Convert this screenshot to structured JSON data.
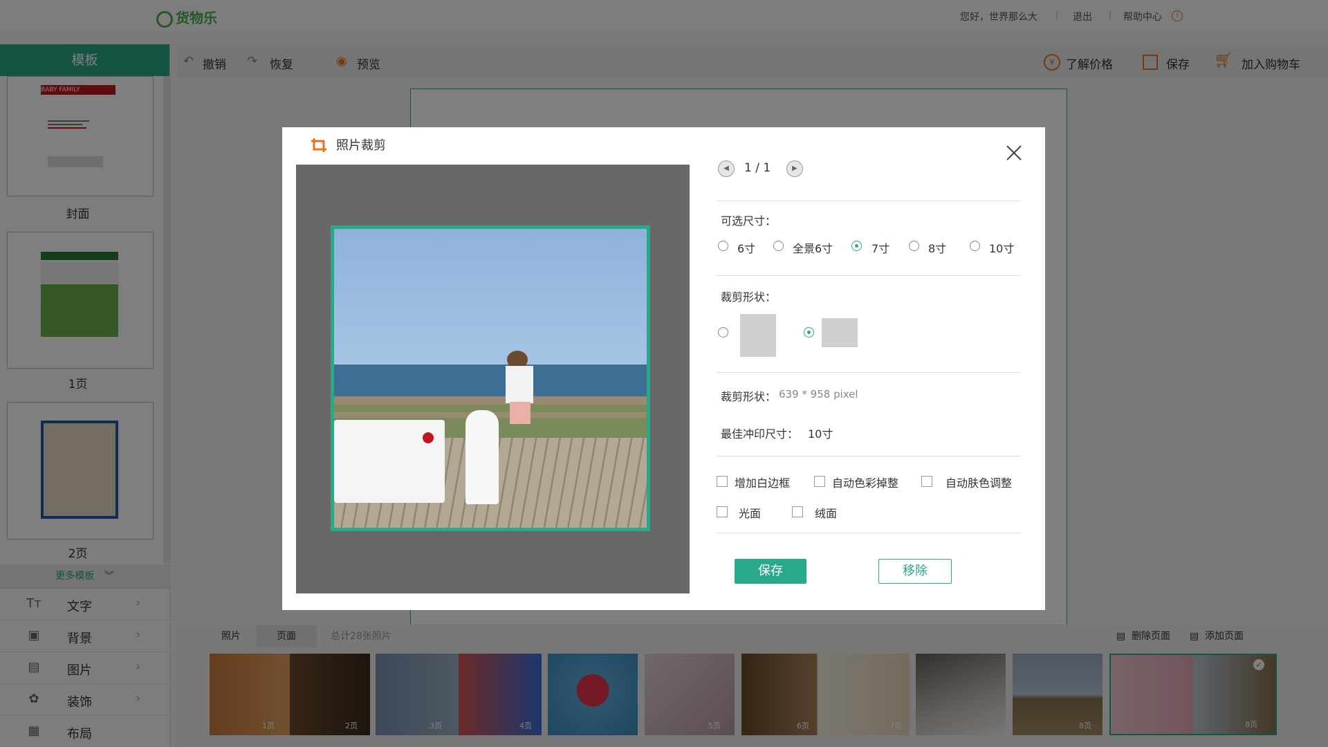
{
  "topbar": {
    "logo": "货物乐",
    "greeting": "您好，世界那么大",
    "logout": "退出",
    "help": "帮助中心",
    "separator": "|"
  },
  "sidebar": {
    "header": "模板",
    "thumbs": [
      {
        "label": "封面",
        "title": "BABY FAMILY"
      },
      {
        "label": "1页"
      },
      {
        "label": "2页"
      }
    ],
    "more": "更多模板",
    "tools": [
      {
        "label": "文字",
        "icon": "text-icon"
      },
      {
        "label": "背景",
        "icon": "background-icon"
      },
      {
        "label": "图片",
        "icon": "image-icon"
      },
      {
        "label": "装饰",
        "icon": "decoration-icon"
      },
      {
        "label": "布局",
        "icon": "layout-icon"
      }
    ]
  },
  "toolbar": {
    "undo": "撤销",
    "redo": "恢复",
    "preview": "预览",
    "price": "了解价格",
    "save": "保存",
    "cart": "加入购物车"
  },
  "bottom": {
    "tab_photos": "照片",
    "tab_pages": "页面",
    "total": "总计28张照片",
    "delete_page": "删除页面",
    "add_page": "添加页面",
    "pages": [
      "1页",
      "2页",
      "3页",
      "4页",
      "5页",
      "6页",
      "7页",
      "8页",
      "8页"
    ]
  },
  "modal": {
    "title": "照片裁剪",
    "pager": "1 / 1",
    "sizes_label": "可选尺寸：",
    "sizes": [
      "6寸",
      "全景6寸",
      "7寸",
      "8寸",
      "10寸"
    ],
    "selected_size": "7寸",
    "shape_label": "裁剪形状：",
    "crop_info_label": "裁剪形状：",
    "crop_info_value": "639 * 958  pixel",
    "best_label": "最佳冲印尺寸：",
    "best_value": "10寸",
    "options": [
      "增加白边框",
      "自动色彩掉整",
      "自动肤色调整",
      "光面",
      "绒面"
    ],
    "save": "保存",
    "remove": "移除"
  },
  "colors": {
    "accent": "#2aa88a",
    "orange": "#e8731f"
  }
}
